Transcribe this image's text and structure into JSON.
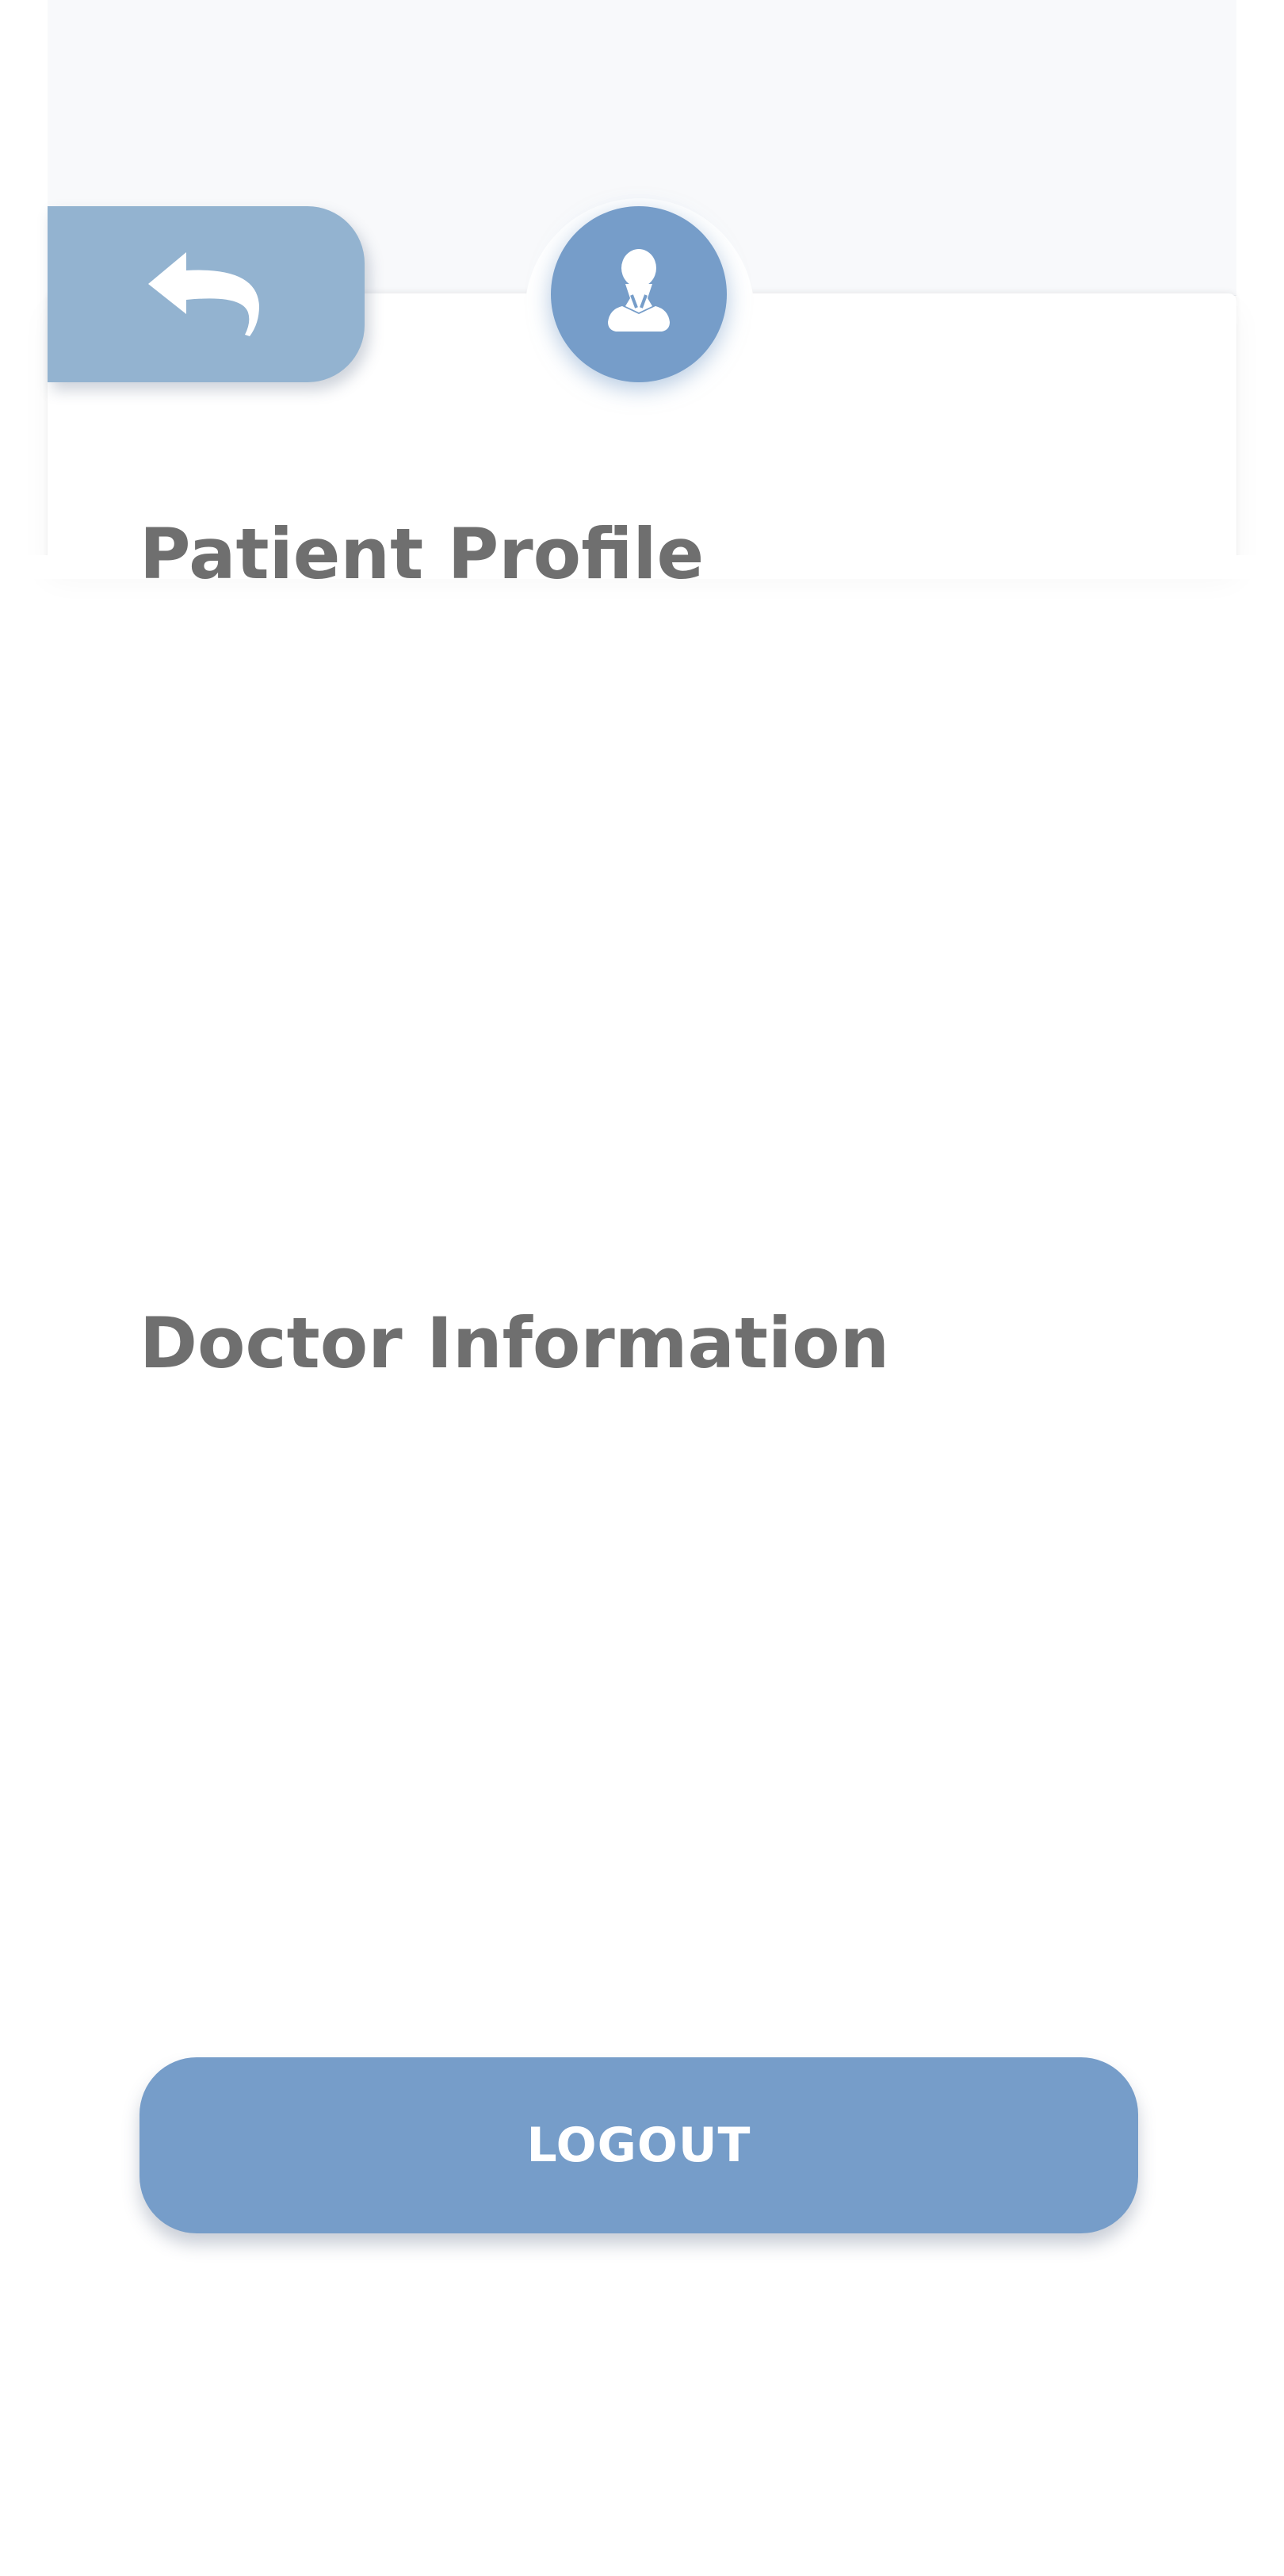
{
  "header": {
    "back_icon": "back-arrow-icon",
    "avatar_icon": "user-silhouette-icon"
  },
  "sections": {
    "patient_profile": {
      "title": "Patient Profile"
    },
    "doctor_information": {
      "title": "Doctor Information"
    }
  },
  "actions": {
    "logout_label": "LOGOUT"
  },
  "colors": {
    "accent": "#769dc9",
    "back_button": "#93b3d0",
    "heading_text": "#6f6f6f",
    "background": "#ffffff",
    "header_band": "#f8f9fb"
  }
}
